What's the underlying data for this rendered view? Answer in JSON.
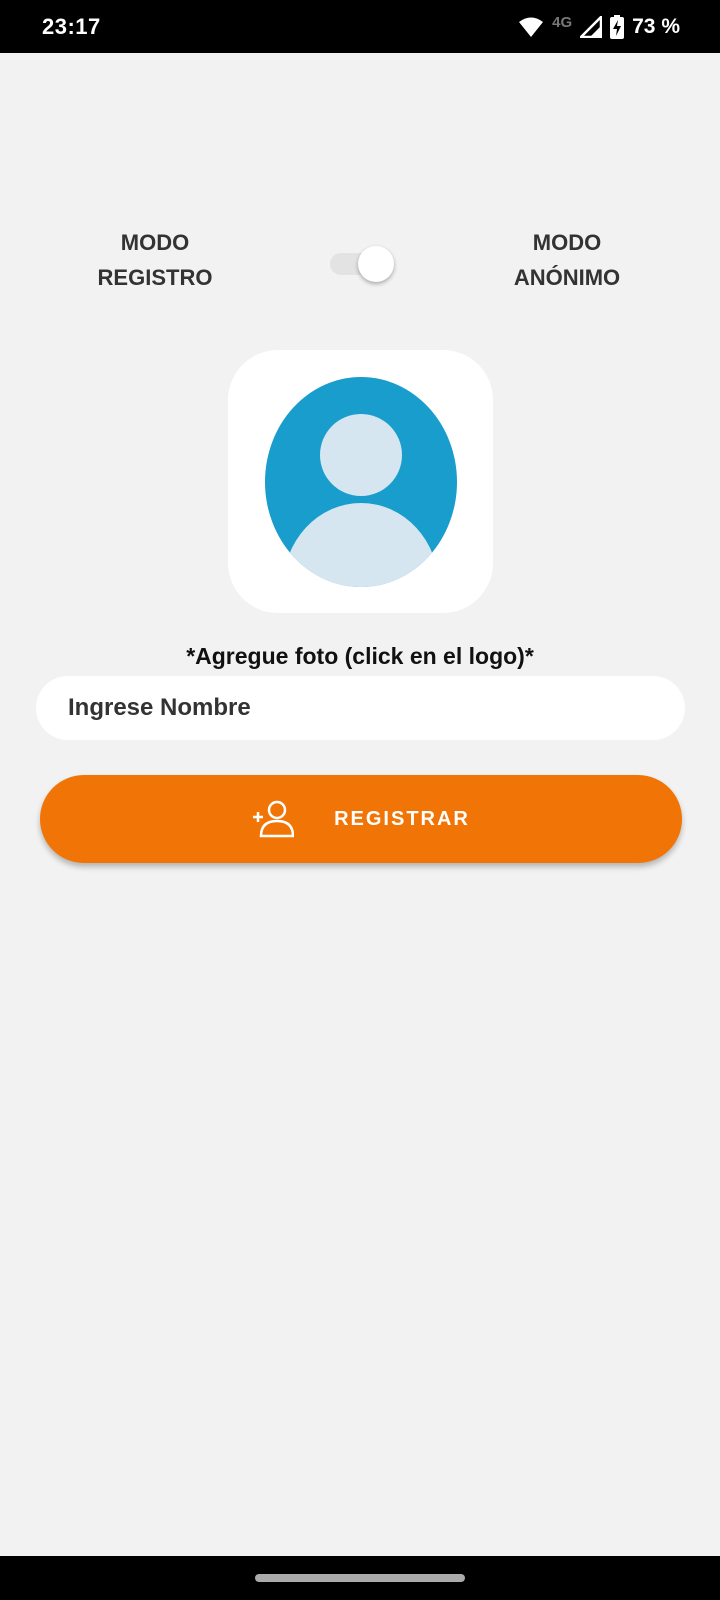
{
  "status_bar": {
    "time": "23:17",
    "network": "4G",
    "battery": "73 %",
    "icons": [
      "wifi-icon",
      "signal-icon",
      "battery-charging-icon"
    ]
  },
  "mode_toggle": {
    "left_label_line1": "MODO",
    "left_label_line2": "REGISTRO",
    "right_label_line1": "MODO",
    "right_label_line2": "ANÓNIMO",
    "state": "on"
  },
  "avatar": {
    "icon": "user-avatar-icon",
    "circle_color": "#189dcc",
    "figure_color": "#d6e6f1"
  },
  "hint": "*Agregue foto (click en el logo)*",
  "name_input": {
    "placeholder": "Ingrese Nombre",
    "value": ""
  },
  "register_button": {
    "label": "REGISTRAR",
    "icon": "add-user-icon",
    "color": "#f07506"
  }
}
